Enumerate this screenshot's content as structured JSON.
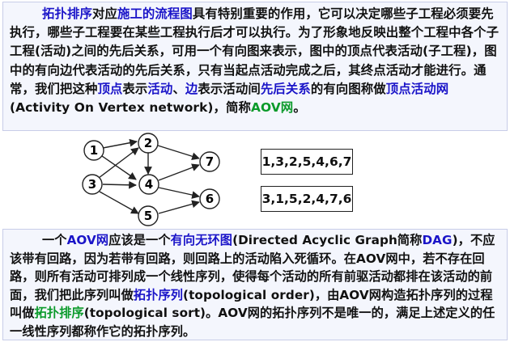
{
  "paragraph_top": {
    "t1": "拓扑排序",
    "t2": "对应",
    "t3": "施工的流程图",
    "t4": "具有特别重要的作用，它可以决定哪些子工程必须要先执行，哪些子工程要在某些工程执行后才可以执行。为了形象地反映出整个工程中各个子工程(活动)之间的先后关系，可用一个有向图来表示，图中的顶点代表活动(子工程)，图中的有向边代表活动的先后关系，只有当起点活动完成之后，其终点活动才能进行。通常，我们把这种",
    "t5": "顶点",
    "t6": "表示",
    "t7": "活动",
    "t8": "、",
    "t9": "边",
    "t10": "表示活动间",
    "t11": "先后关系",
    "t12": "的有向图称做",
    "t13": "顶点活动网",
    "t14": "(Activity On Vertex network)，简称",
    "t15": "AOV网",
    "t16": "。"
  },
  "graph": {
    "nodes": [
      "1",
      "2",
      "3",
      "4",
      "5",
      "6",
      "7"
    ]
  },
  "sequences": [
    "1,3,2,5,4,6,7",
    "3,1,5,2,4,7,6"
  ],
  "paragraph_bottom": {
    "t1": "一个",
    "t2": "AOV网",
    "t3": "应该是一个",
    "t4": "有向无环图",
    "t5": "(Directed Acyclic Graph简称",
    "t6": "DAG",
    "t7": ")，不应该带有回路，因为若带有回路，则回路上的活动陷入死循环。在AOV网中，若不存在回路，则所有活动可排列成一个线性序列，使得每个活动的所有前驱活动都排在该活动的前面，我们把此序列叫做",
    "t8": "拓扑序列",
    "t9": "(topological order)，由AOV网构造拓扑序列的过程叫做",
    "t10": "拓扑排序",
    "t11": "(topological sort)。AOV网的拓扑序列不是唯一的，满足上述定义的任一线性序列都称作它的拓扑序列。"
  },
  "colors": {
    "blue_highlight": "#1a14c8",
    "green_highlight": "#0a9a2a",
    "panel_background": "#f4f6fd"
  }
}
